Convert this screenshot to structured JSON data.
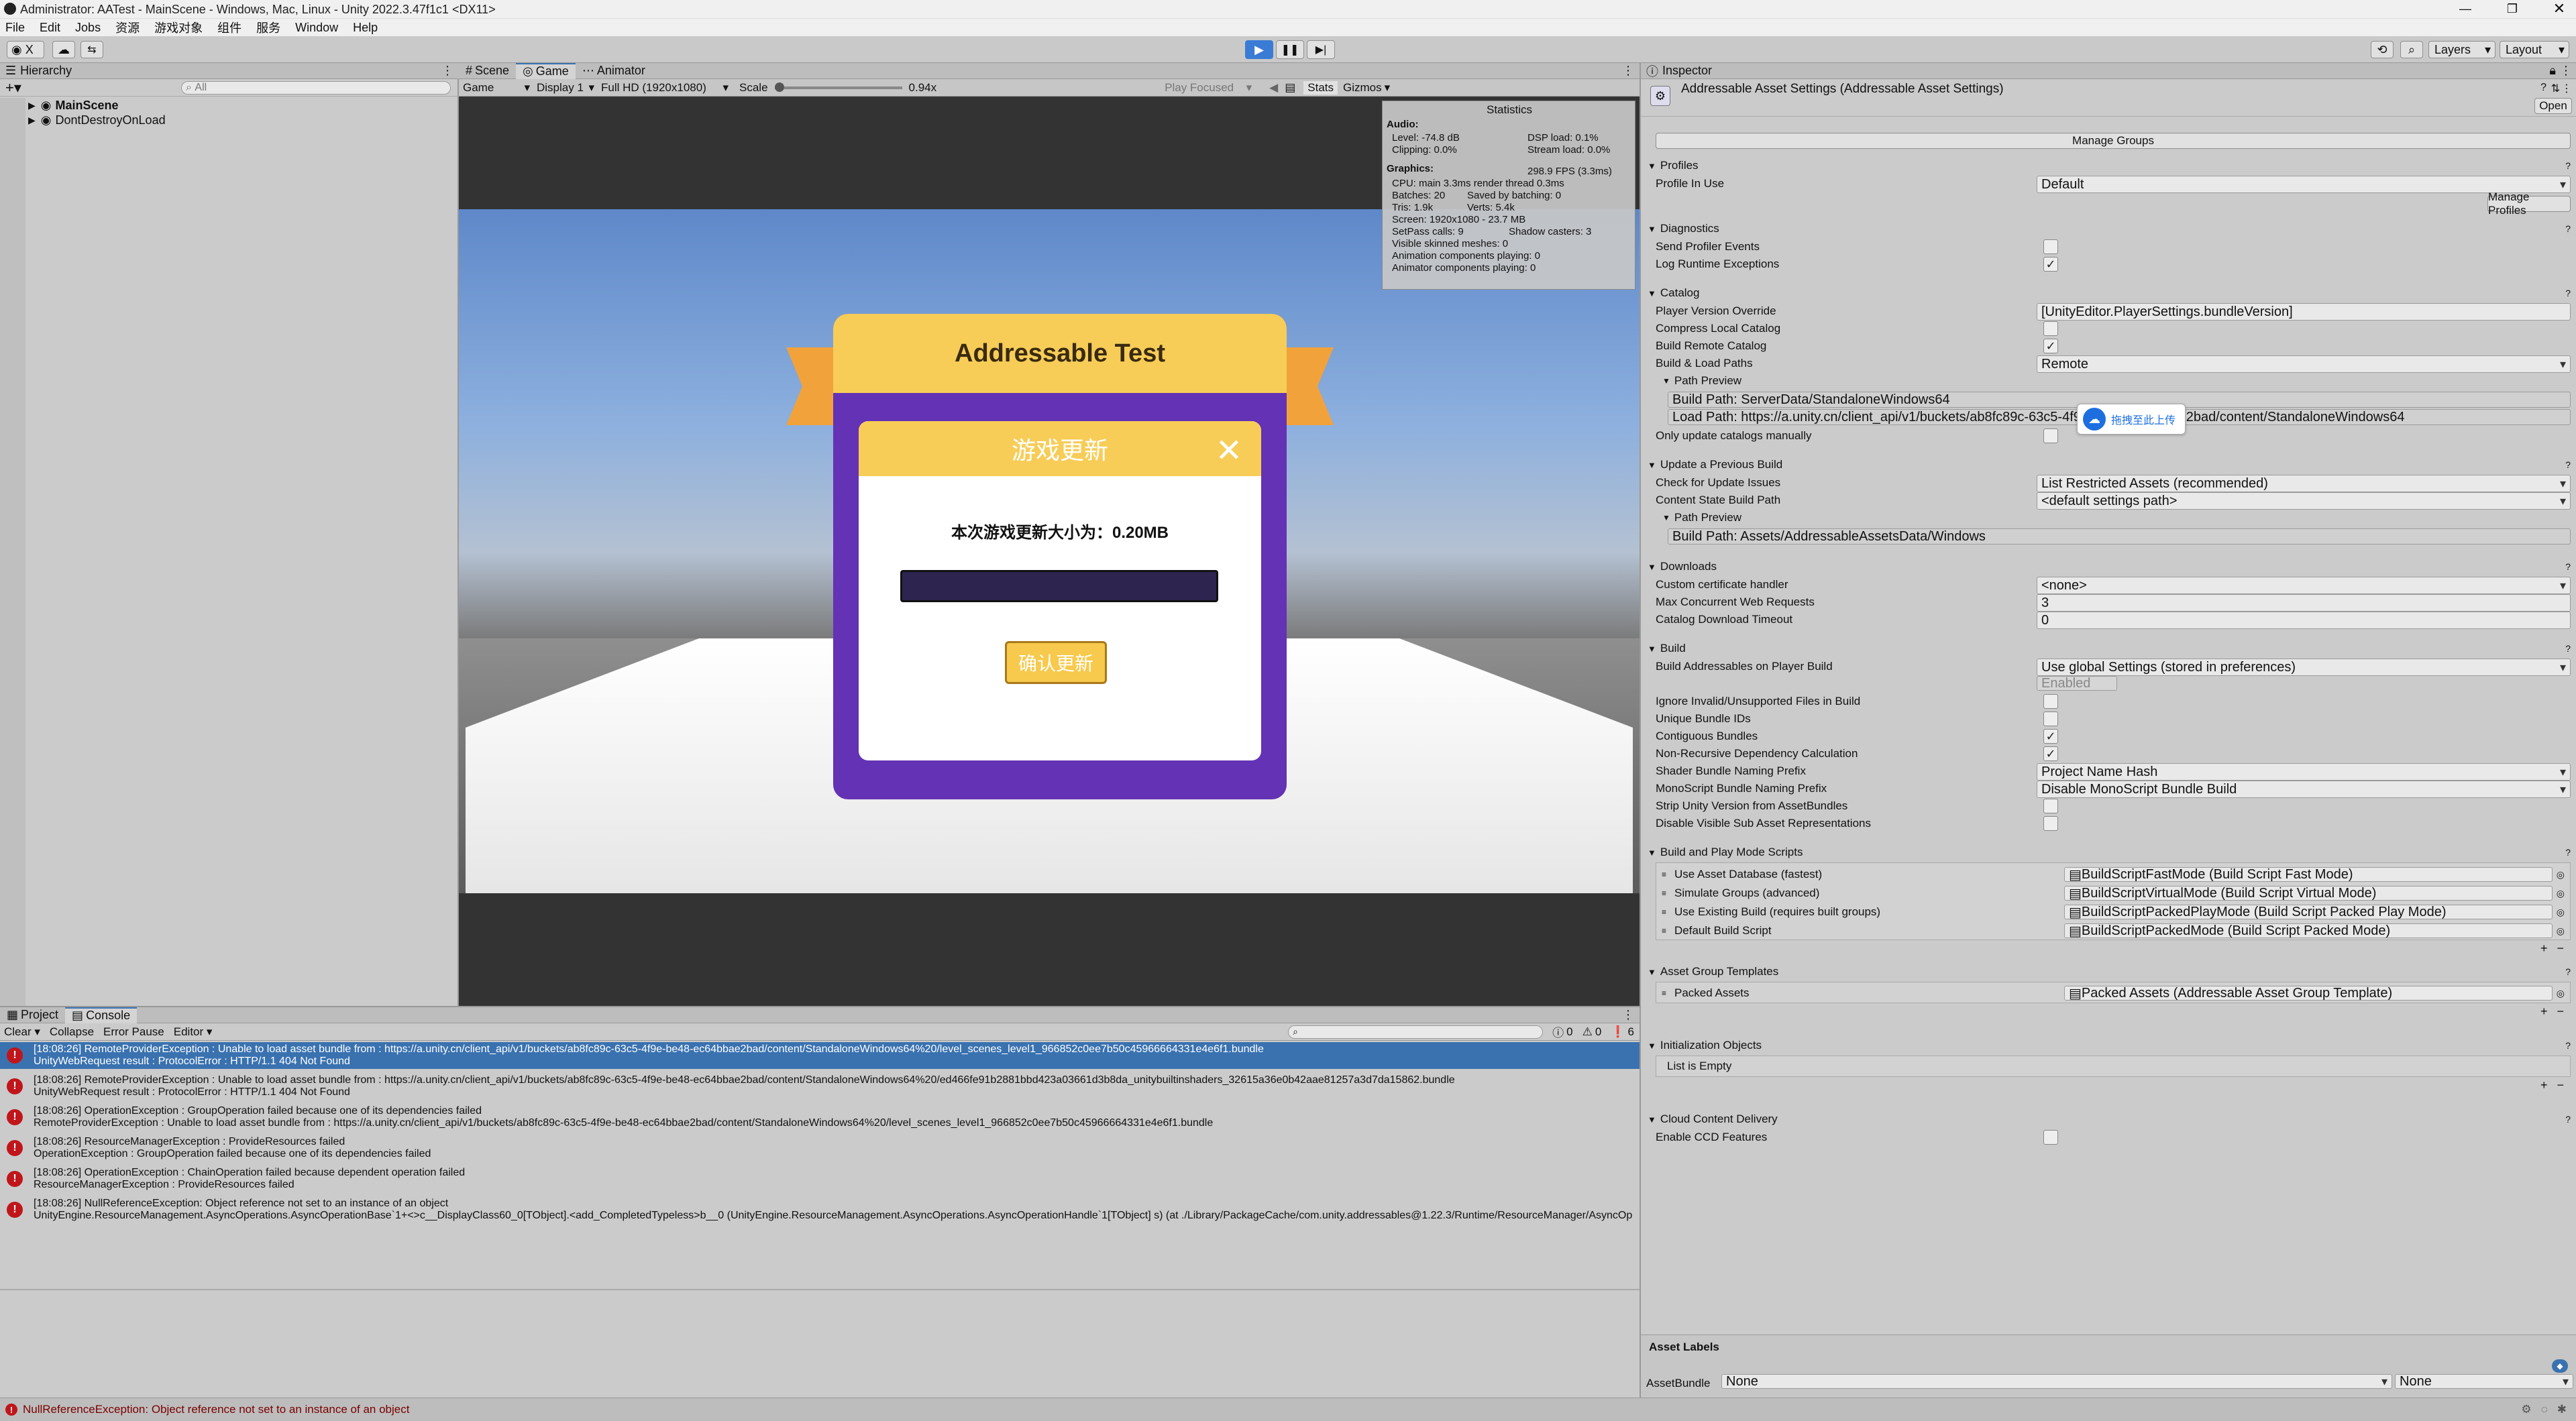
{
  "window": {
    "title": "Administrator: AATest - MainScene - Windows, Mac, Linux - Unity 2022.3.47f1c1 <DX11>"
  },
  "menu": {
    "items": [
      "File",
      "Edit",
      "Jobs",
      "资源",
      "游戏对象",
      "组件",
      "服务",
      "Window",
      "Help"
    ]
  },
  "toolbar": {
    "account_label": "X",
    "layers_label": "Layers",
    "layout_label": "Layout"
  },
  "hierarchy": {
    "tab": "Hierarchy",
    "search_placeholder": "All",
    "items": [
      "MainScene",
      "DontDestroyOnLoad"
    ]
  },
  "viewtabs": [
    "Scene",
    "Game",
    "Animator"
  ],
  "game_toolbar": {
    "mode": "Game",
    "display": "Display 1",
    "resolution": "Full HD (1920x1080)",
    "scale_label": "Scale",
    "scale_value": "0.94x",
    "play_focused": "Play Focused",
    "stats": "Stats",
    "gizmos": "Gizmos"
  },
  "game_ui": {
    "title": "Addressable Test",
    "panel_title": "游戏更新",
    "update_text": "本次游戏更新大小为：0.20MB",
    "confirm_button": "确认更新",
    "progress": 0
  },
  "stats": {
    "title": "Statistics",
    "audio_label": "Audio:",
    "level": "Level: -74.8 dB",
    "dsp": "DSP load: 0.1%",
    "clipping": "Clipping: 0.0%",
    "stream": "Stream load: 0.0%",
    "graphics_label": "Graphics:",
    "fps": "298.9 FPS (3.3ms)",
    "cpu": "CPU: main 3.3ms  render thread 0.3ms",
    "batches": "Batches: 20",
    "saved": "Saved by batching: 0",
    "tris": "Tris: 1.9k",
    "verts": "Verts: 5.4k",
    "screen": "Screen: 1920x1080 - 23.7 MB",
    "setpass": "SetPass calls: 9",
    "shadow": "Shadow casters: 3",
    "skinned": "Visible skinned meshes: 0",
    "anim": "Animation components playing: 0",
    "animator": "Animator components playing: 0"
  },
  "console": {
    "tabs": [
      "Project",
      "Console"
    ],
    "clear": "Clear",
    "collapse": "Collapse",
    "error_pause": "Error Pause",
    "editor": "Editor",
    "count_info": "0",
    "count_warn": "0",
    "count_err": "6",
    "entries": [
      {
        "line1": "[18:08:26] RemoteProviderException : Unable to load asset bundle from : https://a.unity.cn/client_api/v1/buckets/ab8fc89c-63c5-4f9e-be48-ec64bbae2bad/content/StandaloneWindows64%20/level_scenes_level1_966852c0ee7b50c45966664331e4e6f1.bundle",
        "line2": "UnityWebRequest result : ProtocolError : HTTP/1.1 404 Not Found"
      },
      {
        "line1": "[18:08:26] RemoteProviderException : Unable to load asset bundle from : https://a.unity.cn/client_api/v1/buckets/ab8fc89c-63c5-4f9e-be48-ec64bbae2bad/content/StandaloneWindows64%20/ed466fe91b2881bbd423a03661d3b8da_unitybuiltinshaders_32615a36e0b42aae81257a3d7da15862.bundle",
        "line2": "UnityWebRequest result : ProtocolError : HTTP/1.1 404 Not Found"
      },
      {
        "line1": "[18:08:26] OperationException : GroupOperation failed because one of its dependencies failed",
        "line2": "RemoteProviderException : Unable to load asset bundle from : https://a.unity.cn/client_api/v1/buckets/ab8fc89c-63c5-4f9e-be48-ec64bbae2bad/content/StandaloneWindows64%20/level_scenes_level1_966852c0ee7b50c45966664331e4e6f1.bundle"
      },
      {
        "line1": "[18:08:26] ResourceManagerException : ProvideResources failed",
        "line2": "OperationException : GroupOperation failed because one of its dependencies failed"
      },
      {
        "line1": "[18:08:26] OperationException : ChainOperation failed because dependent operation failed",
        "line2": "ResourceManagerException : ProvideResources failed"
      },
      {
        "line1": "[18:08:26] NullReferenceException: Object reference not set to an instance of an object",
        "line2": "UnityEngine.ResourceManagement.AsyncOperations.AsyncOperationBase`1+<>c__DisplayClass60_0[TObject].<add_CompletedTypeless>b__0 (UnityEngine.ResourceManagement.AsyncOperations.AsyncOperationHandle`1[TObject] s) (at ./Library/PackageCache/com.unity.addressables@1.22.3/Runtime/ResourceManager/AsyncOp"
      }
    ],
    "status": "NullReferenceException: Object reference not set to an instance of an object"
  },
  "inspector": {
    "tab": "Inspector",
    "title": "Addressable Asset Settings (Addressable Asset Settings)",
    "open": "Open",
    "manage_groups": "Manage Groups",
    "sections": {
      "profiles": "Profiles",
      "profile_in_use": "Profile In Use",
      "profile_value": "Default",
      "manage_profiles": "Manage Profiles",
      "diagnostics": "Diagnostics",
      "send_profiler": "Send Profiler Events",
      "log_runtime": "Log Runtime Exceptions",
      "catalog": "Catalog",
      "player_version": "Player Version Override",
      "player_version_value": "[UnityEditor.PlayerSettings.bundleVersion]",
      "compress": "Compress Local Catalog",
      "build_remote": "Build Remote Catalog",
      "build_load": "Build & Load Paths",
      "build_load_value": "Remote",
      "path_preview": "Path Preview",
      "build_path": "Build Path: ServerData/StandaloneWindows64",
      "load_path": "Load Path: https://a.unity.cn/client_api/v1/buckets/ab8fc89c-63c5-4f9e-be48-ec64bbae2bad/content/StandaloneWindows64",
      "only_update": "Only update catalogs manually",
      "update_prev": "Update a Previous Build",
      "check_update": "Check for Update Issues",
      "check_update_value": "List Restricted Assets (recommended)",
      "content_state": "Content State Build Path",
      "content_state_value": "<default settings path>",
      "path_preview2": "Path Preview",
      "build_path2": "Build Path: Assets/AddressableAssetsData/Windows",
      "downloads": "Downloads",
      "cert": "Custom certificate handler",
      "cert_value": "<none>",
      "max_web": "Max Concurrent Web Requests",
      "max_web_value": "3",
      "timeout": "Catalog Download Timeout",
      "timeout_value": "0",
      "build": "Build",
      "build_on_player": "Build Addressables on Player Build",
      "build_on_player_value": "Use global Settings (stored in preferences)",
      "enabled": "Enabled",
      "ignore_invalid": "Ignore Invalid/Unsupported Files in Build",
      "unique_ids": "Unique Bundle IDs",
      "contiguous": "Contiguous Bundles",
      "non_recursive": "Non-Recursive Dependency Calculation",
      "shader_prefix": "Shader Bundle Naming Prefix",
      "shader_prefix_value": "Project Name Hash",
      "mono_prefix": "MonoScript Bundle Naming Prefix",
      "mono_prefix_value": "Disable MonoScript Bundle Build",
      "strip_unity": "Strip Unity Version from AssetBundles",
      "disable_visible": "Disable Visible Sub Asset Representations",
      "build_play": "Build and Play Mode Scripts",
      "play_scripts": [
        {
          "label": "Use Asset Database (fastest)",
          "value": "BuildScriptFastMode (Build Script Fast Mode)"
        },
        {
          "label": "Simulate Groups (advanced)",
          "value": "BuildScriptVirtualMode (Build Script Virtual Mode)"
        },
        {
          "label": "Use Existing Build (requires built groups)",
          "value": "BuildScriptPackedPlayMode (Build Script Packed Play Mode)"
        },
        {
          "label": "Default Build Script",
          "value": "BuildScriptPackedMode (Build Script Packed Mode)"
        }
      ],
      "group_templates": "Asset Group Templates",
      "packed_assets": "Packed Assets",
      "packed_assets_value": "Packed Assets (Addressable Asset Group Template)",
      "init_objects": "Initialization Objects",
      "list_empty": "List is Empty",
      "ccd": "Cloud Content Delivery",
      "enable_ccd": "Enable CCD Features",
      "asset_labels": "Asset Labels",
      "asset_bundle": "AssetBundle",
      "asset_bundle_value": "None",
      "asset_bundle_variant": "None"
    }
  },
  "overlay": {
    "upload_badge": "拖拽至此上传"
  },
  "colors": {
    "accent": "#3a72b0",
    "panel_yellow": "#f7cd58",
    "panel_purple": "#6432b4",
    "error_red": "#c0161b"
  }
}
